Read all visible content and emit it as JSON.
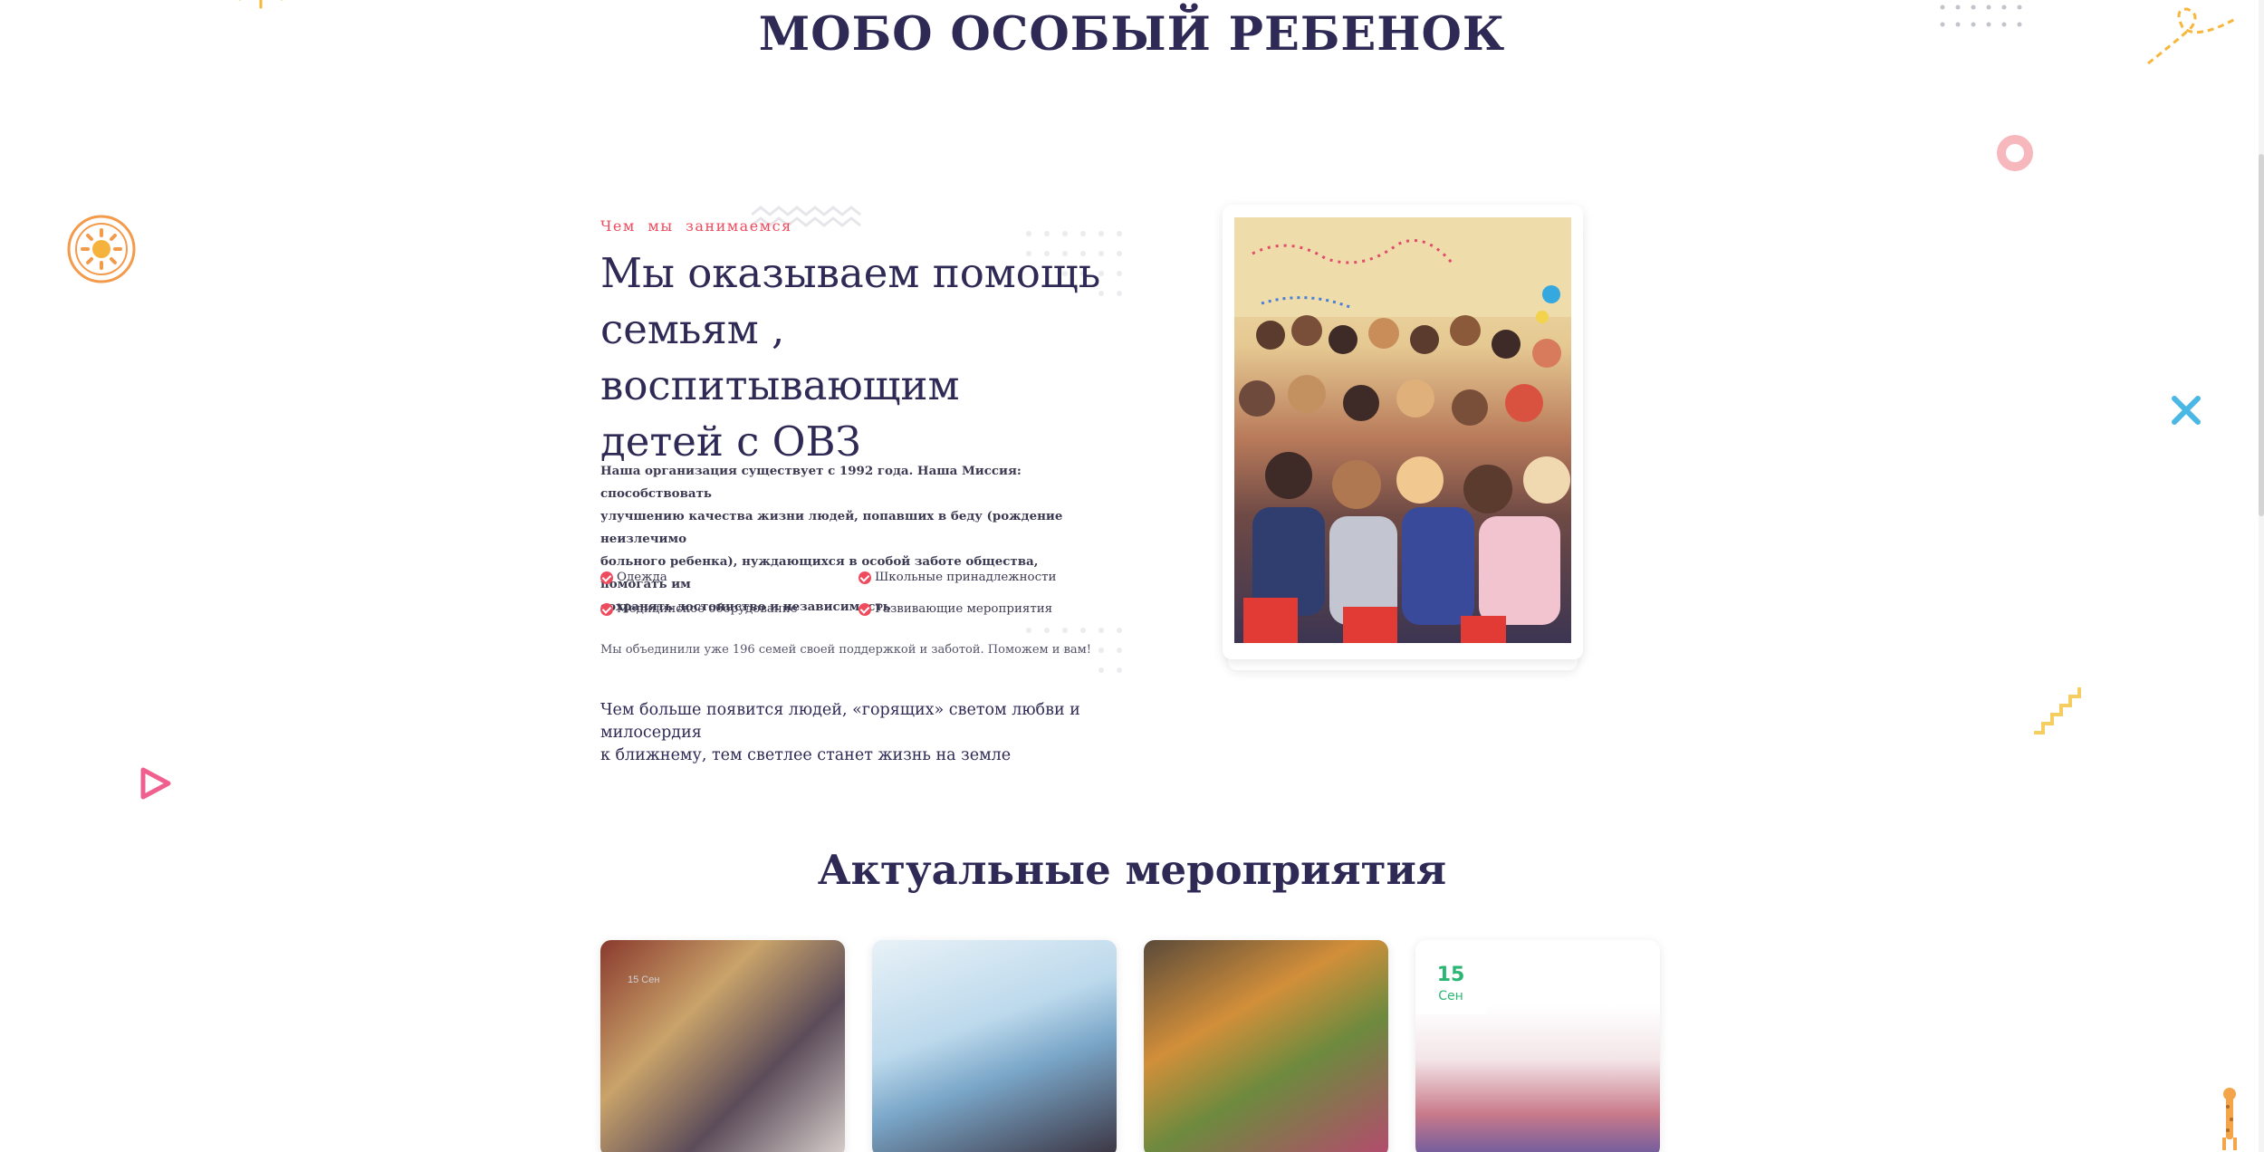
{
  "site": {
    "title": "МОБО ОСОБЫЙ РЕБЕНОК"
  },
  "about": {
    "eyebrow": "Чем мы занимаемся",
    "heading_lines": [
      "Мы оказываем помощь",
      "семьям , воспитывающим",
      "детей с ОВЗ"
    ],
    "mission_lines": [
      "Наша организация существует с 1992 года. Наша Миссия: способствовать",
      "улучшению качества жизни людей, попавших в беду (рождение неизлечимо",
      "больного ребенка), нуждающихся в особой заботе общества, помогать им",
      "сохранять достоинство и независимость"
    ],
    "features": [
      "Одежда",
      "Школьные принадлежности",
      "Медицинское оборудование",
      "Развивающие мероприятия"
    ],
    "support_text": "Мы объединили уже 196 семей своей поддержкой и заботой. Поможем и вам!",
    "quote_lines": [
      "Чем больше появится людей, «горящих» светом любви и милосердия",
      "к ближнему, тем светлее станет жизнь на земле"
    ]
  },
  "events": {
    "title": "Актуальные мероприятия",
    "featured_date": {
      "day": "15",
      "month": "Сен"
    },
    "photo_caption": "15 Сен"
  },
  "colors": {
    "heading": "#2e2a55",
    "accent": "#ee4c5e",
    "date": "#2bb673"
  }
}
